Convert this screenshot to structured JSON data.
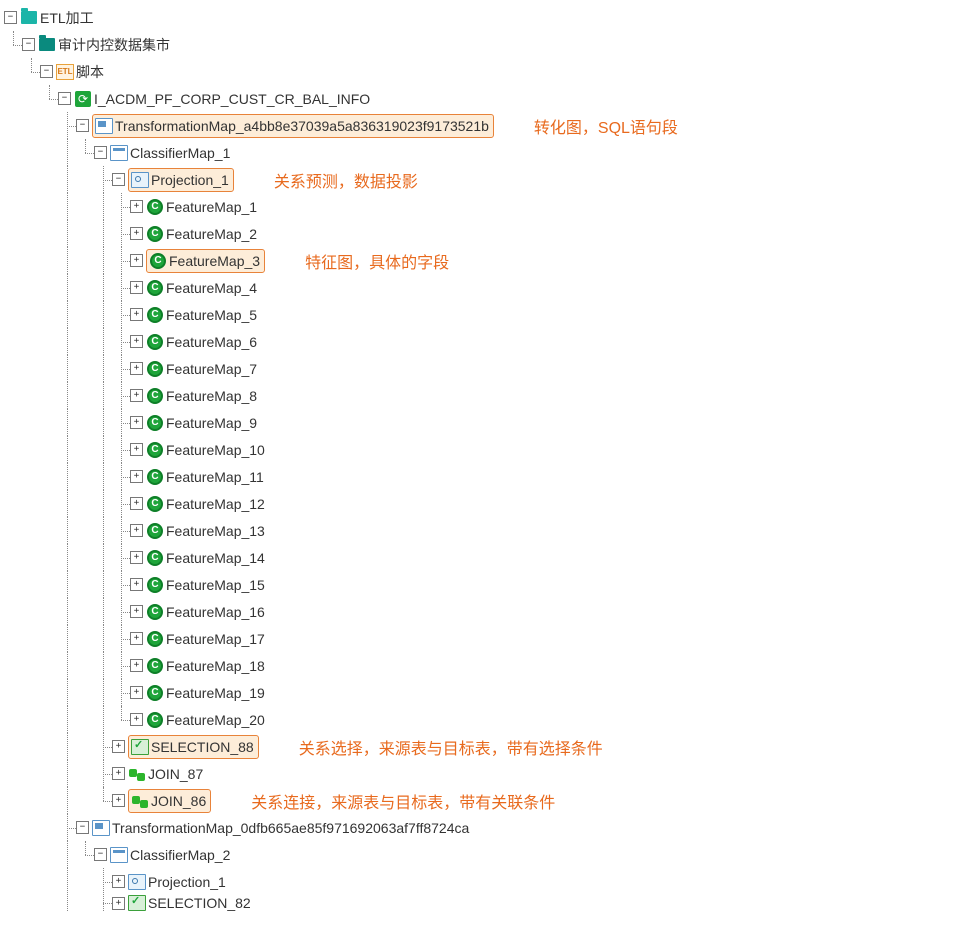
{
  "tree": {
    "root_label": "ETL加工",
    "datamart_label": "审计内控数据集市",
    "script_label": "脚本",
    "etl_text": "ETL",
    "task_label": "I_ACDM_PF_CORP_CUST_CR_BAL_INFO",
    "tmap1_label": "TransformationMap_a4bb8e37039a5a836319023f9173521b",
    "classifier1_label": "ClassifierMap_1",
    "projection1_label": "Projection_1",
    "features": [
      "FeatureMap_1",
      "FeatureMap_2",
      "FeatureMap_3",
      "FeatureMap_4",
      "FeatureMap_5",
      "FeatureMap_6",
      "FeatureMap_7",
      "FeatureMap_8",
      "FeatureMap_9",
      "FeatureMap_10",
      "FeatureMap_11",
      "FeatureMap_12",
      "FeatureMap_13",
      "FeatureMap_14",
      "FeatureMap_15",
      "FeatureMap_16",
      "FeatureMap_17",
      "FeatureMap_18",
      "FeatureMap_19",
      "FeatureMap_20"
    ],
    "selection_label": "SELECTION_88",
    "join87_label": "JOIN_87",
    "join86_label": "JOIN_86",
    "tmap2_label": "TransformationMap_0dfb665ae85f971692063af7ff8724ca",
    "classifier2_label": "ClassifierMap_2",
    "projection2_label": "Projection_1",
    "selection2_label": "SELECTION_82"
  },
  "annotations": {
    "tmap": "转化图，SQL语句段",
    "projection": "关系预测，数据投影",
    "feature": "特征图，具体的字段",
    "selection": "关系选择，来源表与目标表，带有选择条件",
    "join": "关系连接，来源表与目标表，带有关联条件"
  },
  "glyphs": {
    "minus": "−",
    "plus": "+",
    "refresh": "⟳",
    "feat": "C"
  }
}
